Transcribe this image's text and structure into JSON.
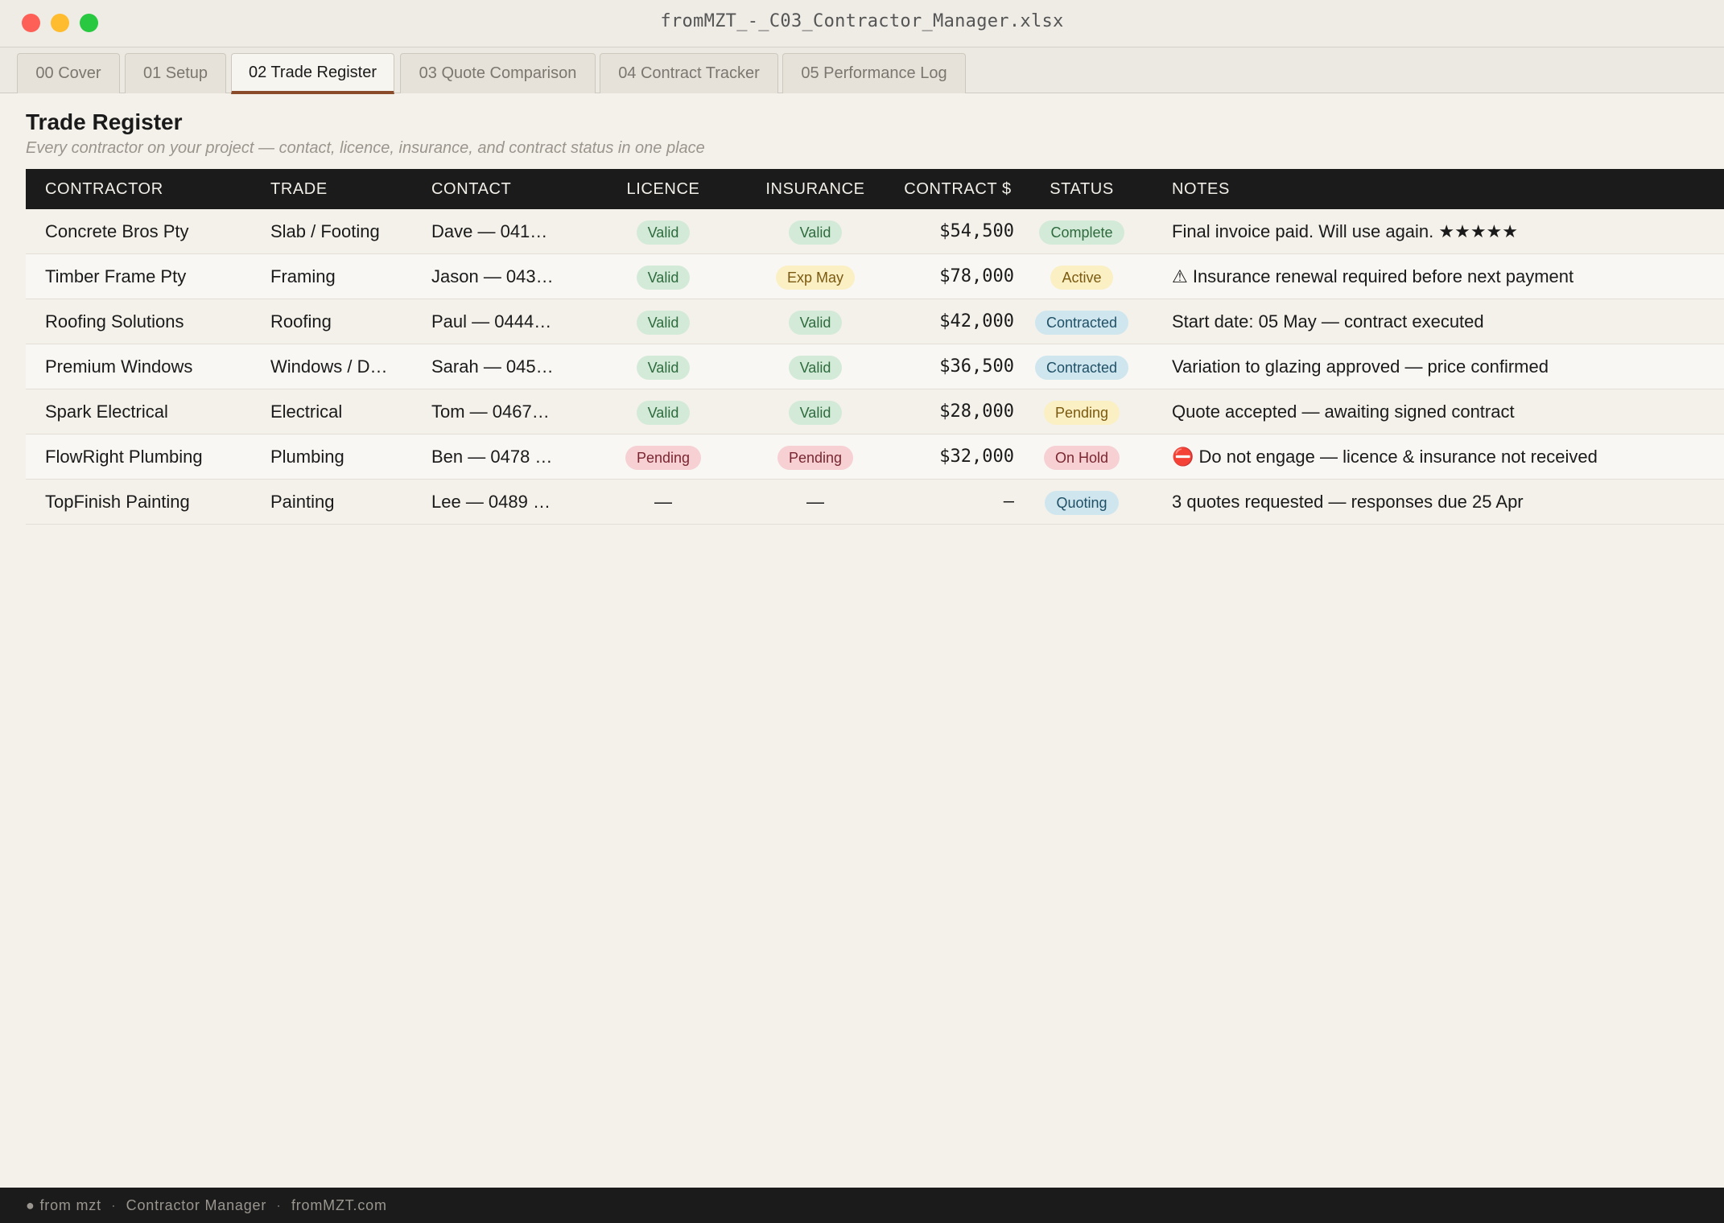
{
  "window": {
    "title": "fromMZT_-_C03_Contractor_Manager.xlsx"
  },
  "tabs": [
    {
      "label": "00 Cover"
    },
    {
      "label": "01 Setup"
    },
    {
      "label": "02 Trade Register"
    },
    {
      "label": "03 Quote Comparison"
    },
    {
      "label": "04 Contract Tracker"
    },
    {
      "label": "05 Performance Log"
    }
  ],
  "active_tab": "02 Trade Register",
  "sheet": {
    "title": "Trade Register",
    "subtitle": "Every contractor on your project — contact, licence, insurance, and contract status in one place"
  },
  "table": {
    "headers": {
      "contractor": "CONTRACTOR",
      "trade": "TRADE",
      "contact": "CONTACT",
      "licence": "LICENCE",
      "insurance": "INSURANCE",
      "contract": "CONTRACT $",
      "status": "STATUS",
      "notes": "NOTES"
    },
    "rows": [
      {
        "contractor": "Concrete Bros Pty",
        "trade": "Slab / Footing",
        "contact": "Dave — 041…",
        "licence": "Valid",
        "insurance": "Valid",
        "contract": "$54,500",
        "status": "Complete",
        "notes": "Final invoice paid. Will use again. ★★★★★"
      },
      {
        "contractor": "Timber Frame Pty",
        "trade": "Framing",
        "contact": "Jason — 043…",
        "licence": "Valid",
        "insurance": "Exp May",
        "contract": "$78,000",
        "status": "Active",
        "notes": "⚠ Insurance renewal required before next payment"
      },
      {
        "contractor": "Roofing Solutions",
        "trade": "Roofing",
        "contact": "Paul — 0444…",
        "licence": "Valid",
        "insurance": "Valid",
        "contract": "$42,000",
        "status": "Contracted",
        "notes": "Start date: 05 May — contract executed"
      },
      {
        "contractor": "Premium Windows",
        "trade": "Windows / D…",
        "contact": "Sarah — 045…",
        "licence": "Valid",
        "insurance": "Valid",
        "contract": "$36,500",
        "status": "Contracted",
        "notes": "Variation to glazing approved — price confirmed"
      },
      {
        "contractor": "Spark Electrical",
        "trade": "Electrical",
        "contact": "Tom — 0467…",
        "licence": "Valid",
        "insurance": "Valid",
        "contract": "$28,000",
        "status": "Pending",
        "notes": "Quote accepted — awaiting signed contract"
      },
      {
        "contractor": "FlowRight Plumbing",
        "trade": "Plumbing",
        "contact": "Ben — 0478 …",
        "licence": "Pending",
        "insurance": "Pending",
        "contract": "$32,000",
        "status": "On Hold",
        "notes": "⛔ Do not engage — licence & insurance not received"
      },
      {
        "contractor": "TopFinish Painting",
        "trade": "Painting",
        "contact": "Lee — 0489 …",
        "licence": "—",
        "insurance": "—",
        "contract": "–",
        "status": "Quoting",
        "notes": "3 quotes requested — responses due 25 Apr"
      }
    ]
  },
  "pill_colors": {
    "Valid": "green",
    "Complete": "green",
    "Exp May": "yellow",
    "Active": "yellow",
    "Pending": "red",
    "On Hold": "red",
    "Contracted": "blue",
    "Quoting": "blue"
  },
  "status_pill_colors": {
    "Pending": "yellow"
  },
  "footer": {
    "brand": "● from mzt",
    "product": "Contractor Manager",
    "site": "fromMZT.com"
  }
}
